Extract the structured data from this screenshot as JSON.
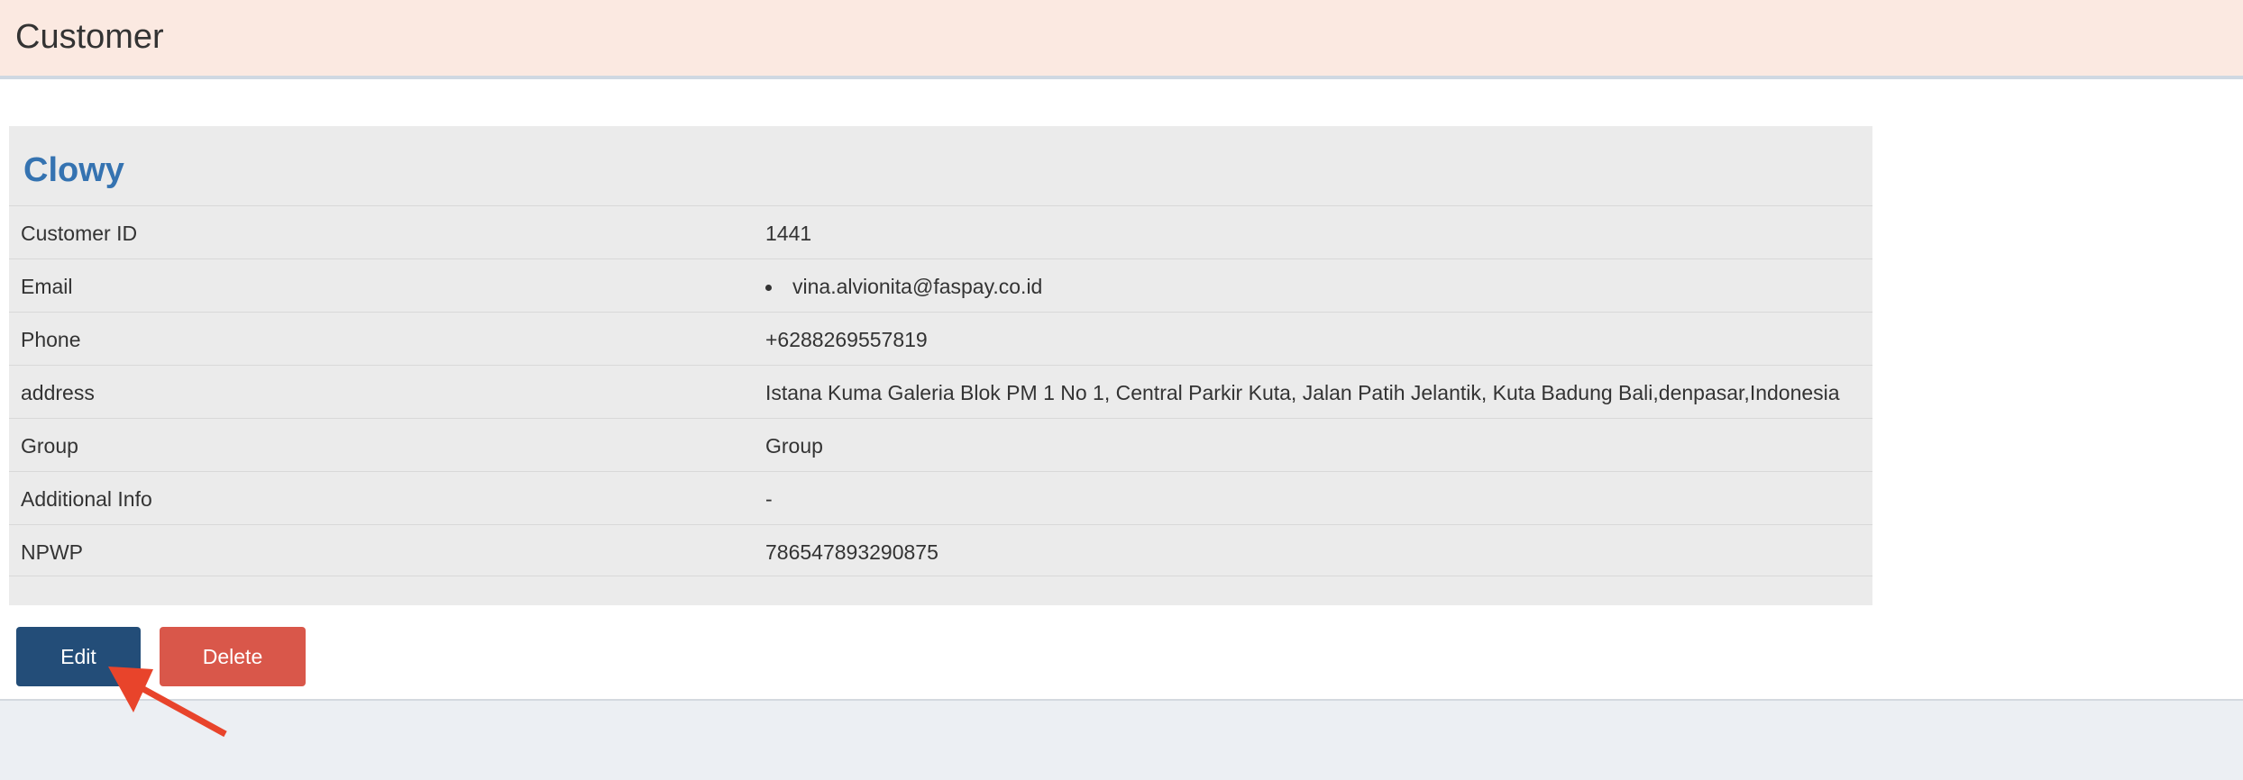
{
  "header": {
    "title": "Customer"
  },
  "customer": {
    "name": "Clowy",
    "fields": [
      {
        "label": "Customer ID",
        "value": "1441"
      },
      {
        "label": "Email",
        "value": "vina.alvionita@faspay.co.id"
      },
      {
        "label": "Phone",
        "value": "+6288269557819"
      },
      {
        "label": "address",
        "value": "Istana Kuma Galeria Blok PM 1 No 1, Central Parkir Kuta, Jalan Patih Jelantik, Kuta Badung Bali,denpasar,Indonesia"
      },
      {
        "label": "Group",
        "value": "Group"
      },
      {
        "label": "Additional Info",
        "value": "-"
      },
      {
        "label": "NPWP",
        "value": "786547893290875"
      }
    ]
  },
  "actions": {
    "edit_label": "Edit",
    "delete_label": "Delete"
  },
  "colors": {
    "header_bg": "#fbe9e1",
    "title_blue": "#3573b1",
    "edit_button": "#234d78",
    "delete_button": "#d9574a",
    "annotation_arrow": "#e8442b"
  },
  "annotation": {
    "icon": "red-pointer-arrow-icon"
  }
}
